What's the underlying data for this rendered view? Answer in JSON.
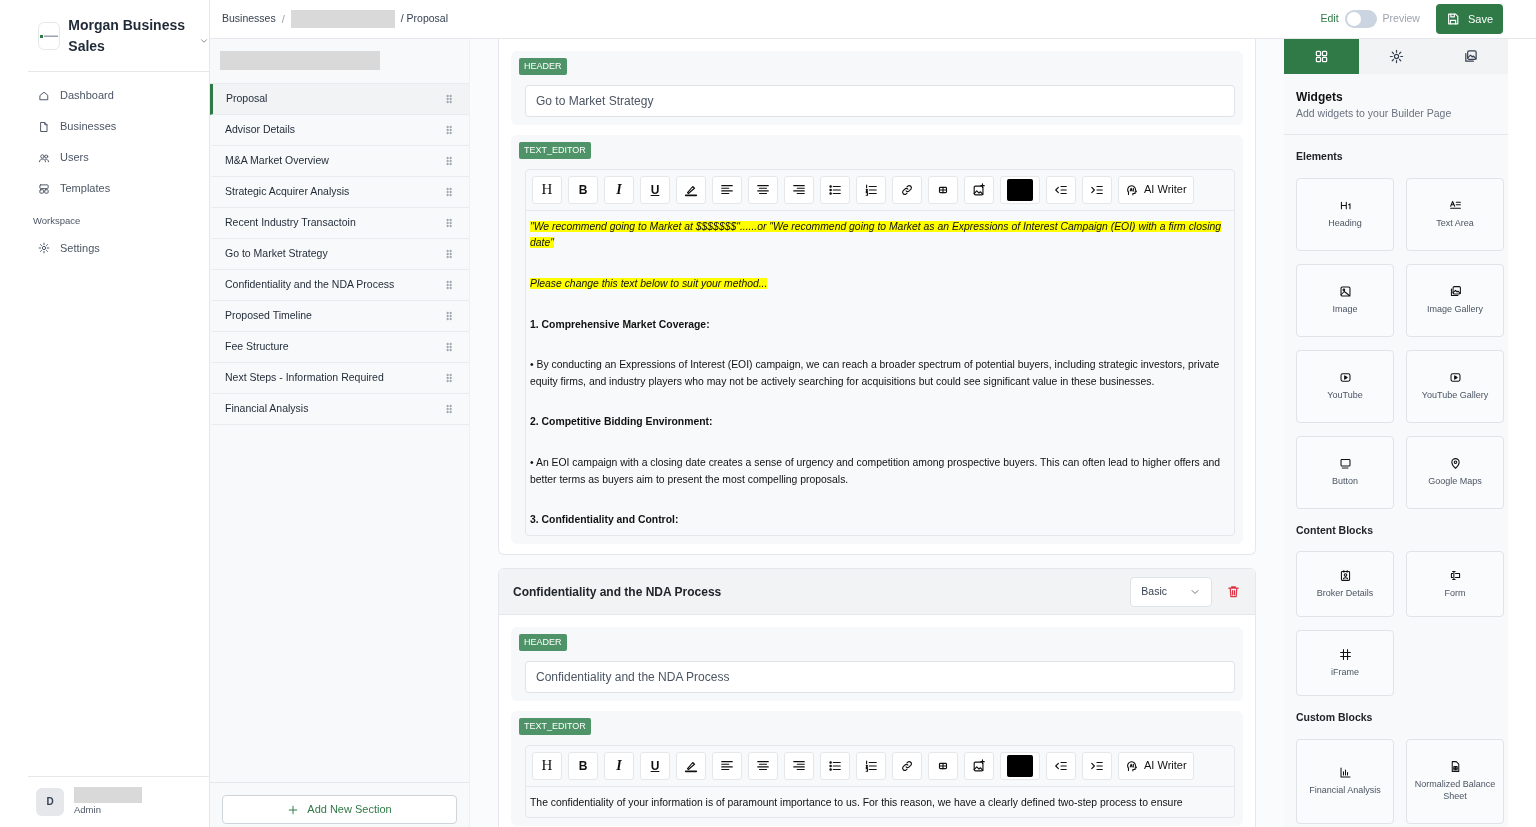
{
  "brand": {
    "name": "Morgan Business Sales"
  },
  "nav": [
    {
      "kind": "home",
      "label": "Dashboard",
      "selected": false
    },
    {
      "kind": "file",
      "label": "Businesses",
      "selected": false
    },
    {
      "kind": "users",
      "label": "Users",
      "selected": false
    },
    {
      "kind": "template",
      "label": "Templates",
      "selected": false
    }
  ],
  "workspace": {
    "title": "Workspace",
    "items": [
      {
        "kind": "gear",
        "label": "Settings",
        "selected": false
      }
    ]
  },
  "user": {
    "initial": "D",
    "role": "Admin"
  },
  "breadcrumb": {
    "first": "Businesses",
    "separator": "/",
    "last": "/ Proposal"
  },
  "mode": {
    "edit_label": "Edit",
    "preview_label": "Preview",
    "on": false
  },
  "save_label": "Save",
  "sections": [
    {
      "label": "Proposal",
      "selected": true
    },
    {
      "label": "Advisor Details",
      "selected": false
    },
    {
      "label": "M&A Market Overview",
      "selected": false
    },
    {
      "label": "Strategic Acquirer Analysis",
      "selected": false
    },
    {
      "label": "Recent Industry Transactoin",
      "selected": false
    },
    {
      "label": "Go to Market Strategy",
      "selected": false
    },
    {
      "label": "Confidentiality and the NDA Process",
      "selected": false
    },
    {
      "label": "Proposed Timeline",
      "selected": false
    },
    {
      "label": "Fee Structure",
      "selected": false
    },
    {
      "label": "Next Steps - Information Required",
      "selected": false
    },
    {
      "label": "Financial Analysis",
      "selected": false
    }
  ],
  "add_section_label": "Add New Section",
  "cards": [
    {
      "header_badge": "HEADER",
      "header_value": "Go to Market Strategy",
      "editor_badge": "TEXT_EDITOR",
      "toolbar": [
        {
          "kind": "heading",
          "label": "H"
        },
        {
          "kind": "bold",
          "label": "B"
        },
        {
          "kind": "italic",
          "label": "I"
        },
        {
          "kind": "underline",
          "label": "U"
        },
        {
          "kind": "highlight"
        },
        {
          "kind": "align-left"
        },
        {
          "kind": "align-center"
        },
        {
          "kind": "align-right"
        },
        {
          "kind": "bullets"
        },
        {
          "kind": "numbers"
        },
        {
          "kind": "link"
        },
        {
          "kind": "table"
        },
        {
          "kind": "image"
        },
        {
          "kind": "color"
        },
        {
          "kind": "outdent"
        },
        {
          "kind": "indent"
        },
        {
          "kind": "ai",
          "label": "AI Writer"
        }
      ],
      "content": [
        {
          "kind": "highlight",
          "text": "\"We recommend going to Market at $$$$$$$\"......or \"We recommend going to Market as an Expressions of Interest Campaign (EOI) with a firm closing date\""
        },
        {
          "kind": "highlight",
          "text": "Please change this text below to suit your method..."
        },
        {
          "kind": "heading",
          "text": "1. Comprehensive Market Coverage:"
        },
        {
          "kind": "body",
          "text": "• By conducting an Expressions of Interest (EOI) campaign, we can reach a broader spectrum of potential buyers, including strategic investors, private equity firms, and industry players who may not be actively searching for acquisitions but could see significant value in these businesses."
        },
        {
          "kind": "heading",
          "text": "2. Competitive Bidding Environment:"
        },
        {
          "kind": "body",
          "text": "• An EOI campaign with a closing date creates a sense of urgency and competition among prospective buyers. This can often lead to higher offers and better terms as buyers aim to present the most compelling proposals."
        },
        {
          "kind": "heading",
          "text": "3. Confidentiality and Control:"
        }
      ]
    },
    {
      "title": "Confidentiality and the NDA Process",
      "layout": "Basic",
      "header_badge": "HEADER",
      "header_value": "Confidentiality and the NDA Process",
      "editor_badge": "TEXT_EDITOR",
      "toolbar": [
        {
          "kind": "heading",
          "label": "H"
        },
        {
          "kind": "bold",
          "label": "B"
        },
        {
          "kind": "italic",
          "label": "I"
        },
        {
          "kind": "underline",
          "label": "U"
        },
        {
          "kind": "highlight"
        },
        {
          "kind": "align-left"
        },
        {
          "kind": "align-center"
        },
        {
          "kind": "align-right"
        },
        {
          "kind": "bullets"
        },
        {
          "kind": "numbers"
        },
        {
          "kind": "link"
        },
        {
          "kind": "table"
        },
        {
          "kind": "image"
        },
        {
          "kind": "color"
        },
        {
          "kind": "outdent"
        },
        {
          "kind": "indent"
        },
        {
          "kind": "ai",
          "label": "AI Writer"
        }
      ],
      "content": [
        {
          "kind": "body",
          "text": "The confidentiality of your information is of paramount importance to us. For this reason, we have a clearly defined two-step process to ensure"
        }
      ]
    }
  ],
  "panel": {
    "tabs": [
      {
        "kind": "widgets",
        "selected": true
      },
      {
        "kind": "settings",
        "selected": false
      },
      {
        "kind": "gallery",
        "selected": false
      }
    ],
    "title": "Widgets",
    "subtitle": "Add widgets to your Builder Page",
    "groups": [
      {
        "title": "Elements",
        "items": [
          {
            "kind": "heading",
            "label": "Heading"
          },
          {
            "kind": "textarea",
            "label": "Text Area"
          },
          {
            "kind": "image",
            "label": "Image"
          },
          {
            "kind": "gallery",
            "label": "Image Gallery"
          },
          {
            "kind": "video",
            "label": "YouTube"
          },
          {
            "kind": "video",
            "label": "YouTube Gallery"
          },
          {
            "kind": "button",
            "label": "Button"
          },
          {
            "kind": "pin",
            "label": "Google Maps"
          }
        ]
      },
      {
        "title": "Content Blocks",
        "items": [
          {
            "kind": "badge",
            "label": "Broker Details"
          },
          {
            "kind": "form",
            "label": "Form"
          },
          {
            "kind": "hash",
            "label": "iFrame"
          }
        ]
      },
      {
        "title": "Custom Blocks",
        "items": [
          {
            "kind": "chart",
            "label": "Financial Analysis"
          },
          {
            "kind": "sheet",
            "label": "Normalized Balance Sheet"
          }
        ]
      }
    ]
  }
}
